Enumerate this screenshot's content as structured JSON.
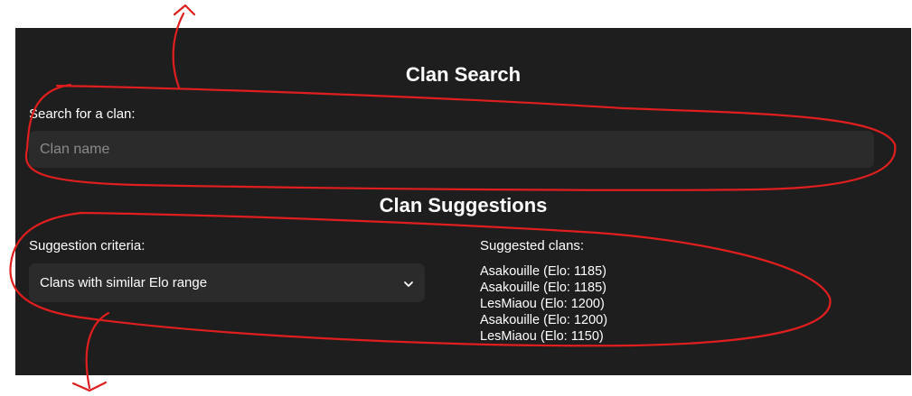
{
  "clan_search": {
    "title": "Clan Search",
    "label": "Search for a clan:",
    "placeholder": "Clan name",
    "value": ""
  },
  "clan_suggestions": {
    "title": "Clan Suggestions",
    "criteria_label": "Suggestion criteria:",
    "criteria_selected": "Clans with similar Elo range",
    "suggested_label": "Suggested clans:",
    "suggested_clans": [
      "Asakouille (Elo: 1185)",
      "Asakouille (Elo: 1185)",
      "LesMiaou (Elo: 1200)",
      "Asakouille (Elo: 1200)",
      "LesMiaou (Elo: 1150)"
    ]
  },
  "icons": {
    "select_chevron": "chevron-down-icon"
  },
  "colors": {
    "panel_background": "#1e1e1e",
    "control_background": "#2b2b2b",
    "text": "#ffffff",
    "placeholder": "#8a8a8a",
    "annotation": "#e01e1e"
  }
}
